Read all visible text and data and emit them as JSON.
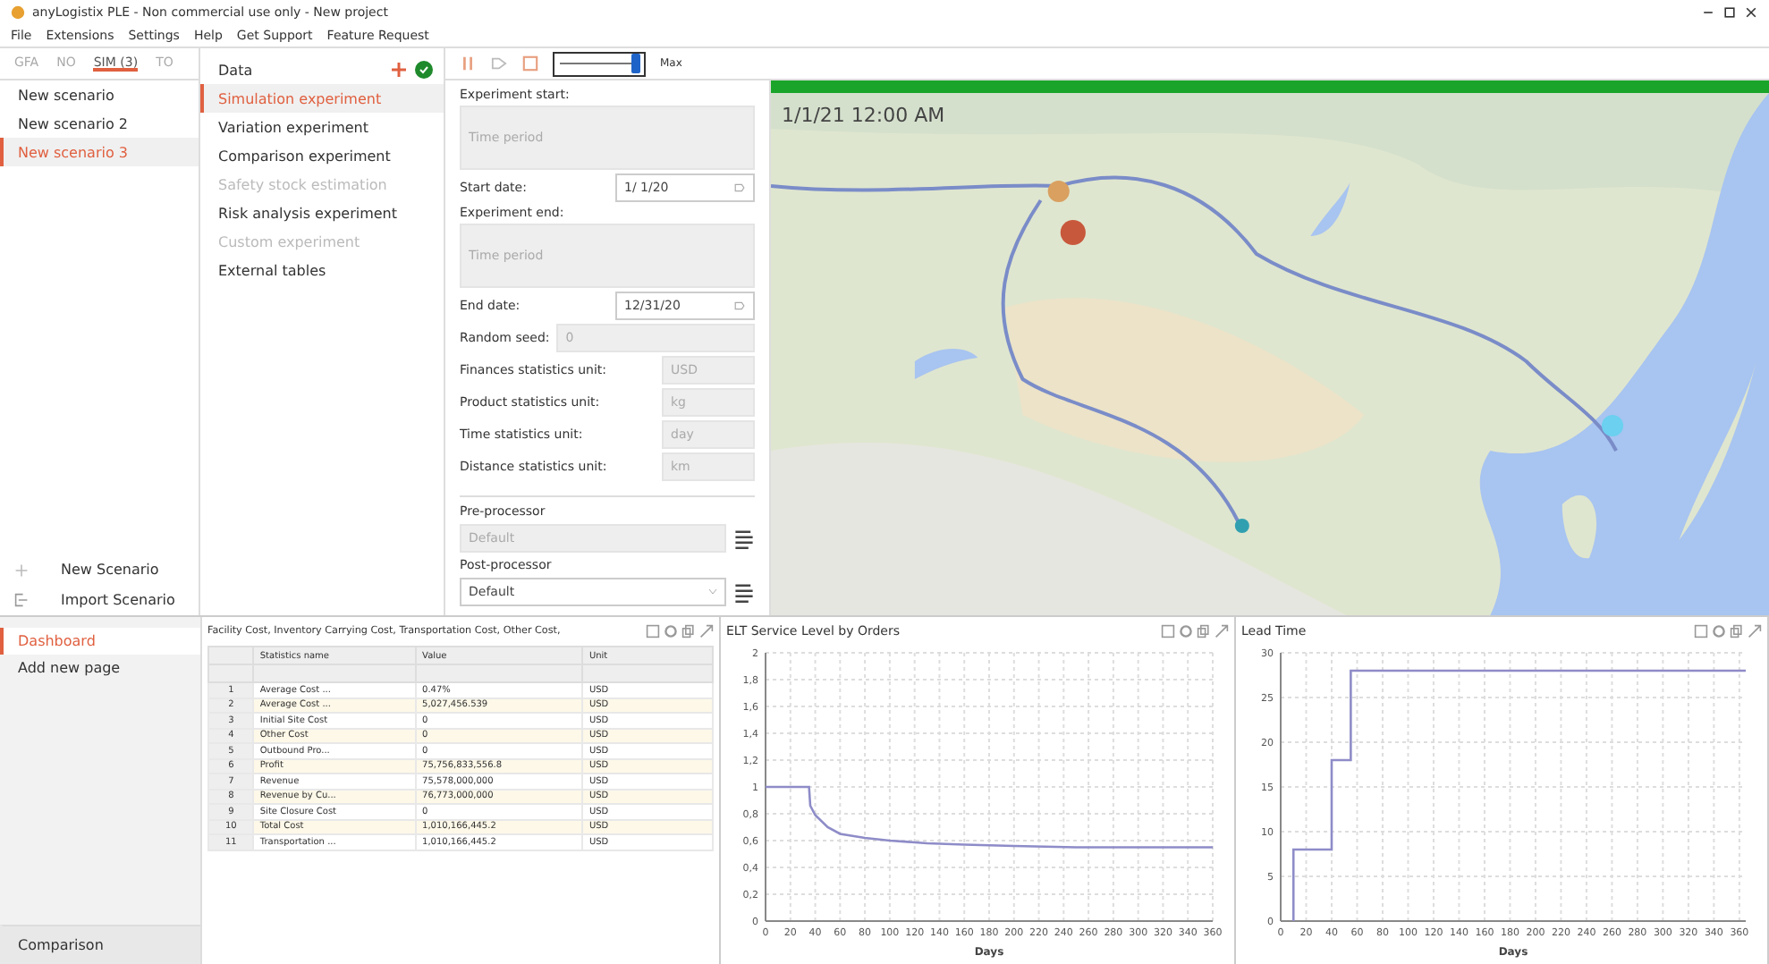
{
  "window": {
    "title": "anyLogistix PLE - Non commercial use only - New project"
  },
  "menu": [
    "File",
    "Extensions",
    "Settings",
    "Help",
    "Get Support",
    "Feature Request"
  ],
  "scenario_tabs": [
    {
      "label": "GFA",
      "selected": false
    },
    {
      "label": "NO",
      "selected": false
    },
    {
      "label": "SIM (3)",
      "selected": true
    },
    {
      "label": "TO",
      "selected": false
    }
  ],
  "scenarios": [
    {
      "label": "New scenario",
      "selected": false
    },
    {
      "label": "New scenario 2",
      "selected": false
    },
    {
      "label": "New scenario 3",
      "selected": true
    }
  ],
  "scenario_actions": [
    {
      "kind": "new",
      "label": "New Scenario"
    },
    {
      "kind": "import",
      "label": "Import Scenario"
    }
  ],
  "experiments": [
    {
      "label": "Data",
      "selected": false,
      "disabled": false,
      "kind": "data"
    },
    {
      "label": "Simulation experiment",
      "selected": true,
      "disabled": false,
      "kind": "item"
    },
    {
      "label": "Variation experiment",
      "selected": false,
      "disabled": false,
      "kind": "item"
    },
    {
      "label": "Comparison experiment",
      "selected": false,
      "disabled": false,
      "kind": "item"
    },
    {
      "label": "Safety stock estimation",
      "selected": false,
      "disabled": true,
      "kind": "item"
    },
    {
      "label": "Risk analysis experiment",
      "selected": false,
      "disabled": false,
      "kind": "item"
    },
    {
      "label": "Custom experiment",
      "selected": false,
      "disabled": true,
      "kind": "item"
    },
    {
      "label": "External tables",
      "selected": false,
      "disabled": false,
      "kind": "item"
    }
  ],
  "toolbar": {
    "speed": {
      "level": 0.95
    },
    "speed_label": "Max"
  },
  "form": [
    {
      "kind": "heading",
      "label": "Experiment start:"
    },
    {
      "kind": "disabled",
      "placeholder": "Time period"
    },
    {
      "kind": "date",
      "label": "Start date:",
      "value": "1/  1/20"
    },
    {
      "kind": "heading",
      "label": "Experiment end:"
    },
    {
      "kind": "disabled",
      "placeholder": "Time period"
    },
    {
      "kind": "date",
      "label": "End date:",
      "value": "12/31/20"
    },
    {
      "kind": "inline",
      "label": "Random seed:",
      "value": "0"
    },
    {
      "kind": "unit",
      "label": "Finances statistics unit:",
      "value": "USD"
    },
    {
      "kind": "unit",
      "label": "Product statistics unit:",
      "value": "kg"
    },
    {
      "kind": "unit",
      "label": "Time statistics unit:",
      "value": "day"
    },
    {
      "kind": "unit",
      "label": "Distance statistics unit:",
      "value": "km"
    },
    {
      "kind": "divider"
    },
    {
      "kind": "heading",
      "label": "Pre-processor"
    },
    {
      "kind": "processor",
      "value": "Default",
      "disabled": true
    },
    {
      "kind": "heading",
      "label": "Post-processor"
    },
    {
      "kind": "processor",
      "value": "Default",
      "disabled": false
    }
  ],
  "map": {
    "progress": {
      "level": 1
    },
    "time": "1/1/21 12:00 AM"
  },
  "dashboard_nav": [
    {
      "label": "Dashboard",
      "selected": true
    },
    {
      "label": "Add new page",
      "selected": false
    }
  ],
  "comparison": "Comparison",
  "table_panel": {
    "title": "Facility Cost, Inventory Carrying Cost, Transportation Cost, Other Cost,",
    "columns": [
      "",
      "Statistics name",
      "Value",
      "Unit"
    ],
    "rows": [
      [
        "1",
        "Average Cost ...",
        "0.47%",
        "USD"
      ],
      [
        "2",
        "Average Cost ...",
        "5,027,456.539",
        "USD"
      ],
      [
        "3",
        "Initial Site Cost",
        "0",
        "USD"
      ],
      [
        "4",
        "Other Cost",
        "0",
        "USD"
      ],
      [
        "5",
        "Outbound Pro...",
        "0",
        "USD"
      ],
      [
        "6",
        "Profit",
        "75,756,833,556.8",
        "USD"
      ],
      [
        "7",
        "Revenue",
        "75,578,000,000",
        "USD"
      ],
      [
        "8",
        "Revenue by Cu...",
        "76,773,000,000",
        "USD"
      ],
      [
        "9",
        "Site Closure Cost",
        "0",
        "USD"
      ],
      [
        "10",
        "Total Cost",
        "1,010,166,445.2",
        "USD"
      ],
      [
        "11",
        "Transportation ...",
        "1,010,166,445.2",
        "USD"
      ]
    ]
  },
  "charts": [
    {
      "chart_data": {
        "type": "line",
        "grid": true,
        "title": "ELT Service Level by Orders",
        "xlabel": "Days",
        "xlim": [
          0,
          360
        ],
        "ylim": [
          0,
          2
        ],
        "xticks": [
          0,
          20,
          40,
          60,
          80,
          100,
          120,
          140,
          160,
          180,
          200,
          220,
          240,
          260,
          280,
          300,
          320,
          340,
          360
        ],
        "yticks": [
          {
            "value": 0,
            "label": "0"
          },
          {
            "value": 0.2,
            "label": "0,2"
          },
          {
            "value": 0.4,
            "label": "0,4"
          },
          {
            "value": 0.6,
            "label": "0,6"
          },
          {
            "value": 0.8,
            "label": "0,8"
          },
          {
            "value": 1,
            "label": "1"
          },
          {
            "value": 1.2,
            "label": "1,2"
          },
          {
            "value": 1.4,
            "label": "1,4"
          },
          {
            "value": 1.6,
            "label": "1,6"
          },
          {
            "value": 1.8,
            "label": "1,8"
          },
          {
            "value": 2,
            "label": "2"
          }
        ],
        "x": [
          0,
          35,
          36,
          40,
          50,
          60,
          80,
          100,
          130,
          160,
          200,
          250,
          300,
          360
        ],
        "series": [
          {
            "color": "#8e8cc8",
            "values": [
              1,
              1,
              0.86,
              0.79,
              0.7,
              0.65,
              0.62,
              0.6,
              0.58,
              0.57,
              0.56,
              0.55,
              0.55,
              0.55
            ]
          }
        ]
      }
    },
    {
      "chart_data": {
        "type": "line",
        "grid": true,
        "title": "Lead Time",
        "xlabel": "Days",
        "xlim": [
          0,
          365
        ],
        "ylim": [
          0,
          30
        ],
        "xticks": [
          0,
          20,
          40,
          60,
          80,
          100,
          120,
          140,
          160,
          180,
          200,
          220,
          240,
          260,
          280,
          300,
          320,
          340,
          360
        ],
        "yticks": [
          0,
          5,
          10,
          15,
          20,
          25,
          30
        ],
        "x": [
          10,
          10,
          40,
          40,
          55,
          55,
          365
        ],
        "series": [
          {
            "color": "#8e8cc8",
            "values": [
              0,
              8,
              8,
              18,
              18,
              28,
              28
            ]
          }
        ]
      }
    }
  ]
}
